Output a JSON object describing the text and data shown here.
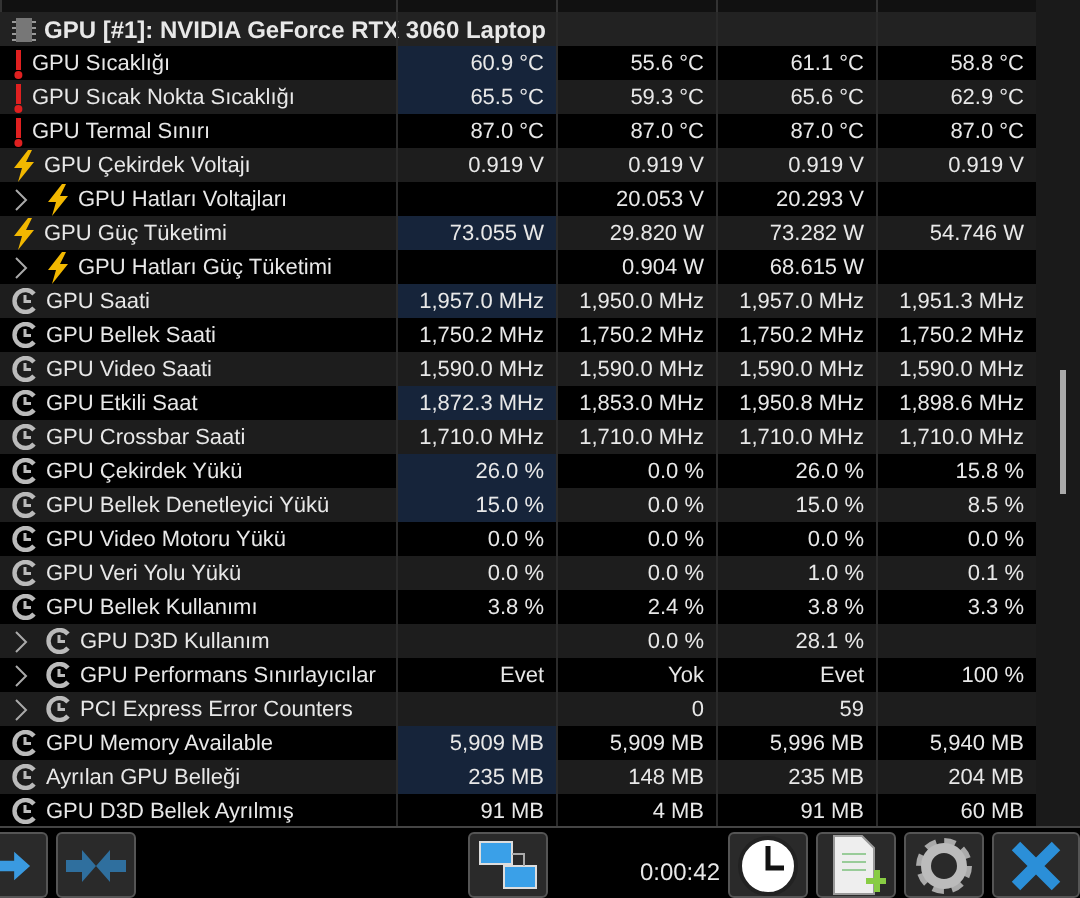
{
  "device": {
    "title": "GPU [#1]: NVIDIA GeForce RTX 3060 Laptop"
  },
  "sensors": [
    {
      "name": "GPU Sıcaklığı",
      "kind": "temperature",
      "highlighted": true,
      "values": {
        "value_1": "60.9 °C",
        "value_2": "55.6 °C",
        "value_3": "61.1 °C",
        "value_4": "58.8 °C"
      }
    },
    {
      "name": "GPU Sıcak Nokta Sıcaklığı",
      "kind": "temperature",
      "highlighted": true,
      "values": {
        "value_1": "65.5 °C",
        "value_2": "59.3 °C",
        "value_3": "65.6 °C",
        "value_4": "62.9 °C"
      }
    },
    {
      "name": "GPU Termal Sınırı",
      "kind": "temperature",
      "highlighted": false,
      "values": {
        "value_1": "87.0 °C",
        "value_2": "87.0 °C",
        "value_3": "87.0 °C",
        "value_4": "87.0 °C"
      }
    },
    {
      "name": "GPU Çekirdek Voltajı",
      "kind": "power",
      "highlighted": false,
      "values": {
        "value_1": "0.919 V",
        "value_2": "0.919 V",
        "value_3": "0.919 V",
        "value_4": "0.919 V"
      }
    },
    {
      "name": "GPU Hatları Voltajları",
      "kind": "power",
      "expanded": false,
      "highlighted": false,
      "values": {
        "value_2": "20.053 V",
        "value_3": "20.293 V"
      }
    },
    {
      "name": "GPU Güç Tüketimi",
      "kind": "power",
      "highlighted": true,
      "values": {
        "value_1": "73.055 W",
        "value_2": "29.820 W",
        "value_3": "73.282 W",
        "value_4": "54.746 W"
      }
    },
    {
      "name": "GPU Hatları Güç Tüketimi",
      "kind": "power",
      "expanded": false,
      "highlighted": false,
      "values": {
        "value_2": "0.904 W",
        "value_3": "68.615 W"
      }
    },
    {
      "name": "GPU Saati",
      "kind": "clock",
      "highlighted": true,
      "values": {
        "value_1": "1,957.0 MHz",
        "value_2": "1,950.0 MHz",
        "value_3": "1,957.0 MHz",
        "value_4": "1,951.3 MHz"
      }
    },
    {
      "name": "GPU Bellek Saati",
      "kind": "clock",
      "highlighted": false,
      "values": {
        "value_1": "1,750.2 MHz",
        "value_2": "1,750.2 MHz",
        "value_3": "1,750.2 MHz",
        "value_4": "1,750.2 MHz"
      }
    },
    {
      "name": "GPU Video Saati",
      "kind": "clock",
      "highlighted": false,
      "values": {
        "value_1": "1,590.0 MHz",
        "value_2": "1,590.0 MHz",
        "value_3": "1,590.0 MHz",
        "value_4": "1,590.0 MHz"
      }
    },
    {
      "name": "GPU Etkili Saat",
      "kind": "clock",
      "highlighted": true,
      "values": {
        "value_1": "1,872.3 MHz",
        "value_2": "1,853.0 MHz",
        "value_3": "1,950.8 MHz",
        "value_4": "1,898.6 MHz"
      }
    },
    {
      "name": "GPU Crossbar Saati",
      "kind": "clock",
      "highlighted": false,
      "values": {
        "value_1": "1,710.0 MHz",
        "value_2": "1,710.0 MHz",
        "value_3": "1,710.0 MHz",
        "value_4": "1,710.0 MHz"
      }
    },
    {
      "name": "GPU Çekirdek Yükü",
      "kind": "clock",
      "highlighted": true,
      "values": {
        "value_1": "26.0 %",
        "value_2": "0.0 %",
        "value_3": "26.0 %",
        "value_4": "15.8 %"
      }
    },
    {
      "name": "GPU Bellek Denetleyici Yükü",
      "kind": "clock",
      "highlighted": true,
      "values": {
        "value_1": "15.0 %",
        "value_2": "0.0 %",
        "value_3": "15.0 %",
        "value_4": "8.5 %"
      }
    },
    {
      "name": "GPU Video Motoru Yükü",
      "kind": "clock",
      "highlighted": false,
      "values": {
        "value_1": "0.0 %",
        "value_2": "0.0 %",
        "value_3": "0.0 %",
        "value_4": "0.0 %"
      }
    },
    {
      "name": "GPU Veri Yolu Yükü",
      "kind": "clock",
      "highlighted": false,
      "values": {
        "value_1": "0.0 %",
        "value_2": "0.0 %",
        "value_3": "1.0 %",
        "value_4": "0.1 %"
      }
    },
    {
      "name": "GPU Bellek Kullanımı",
      "kind": "clock",
      "highlighted": false,
      "values": {
        "value_1": "3.8 %",
        "value_2": "2.4 %",
        "value_3": "3.8 %",
        "value_4": "3.3 %"
      }
    },
    {
      "name": "GPU D3D Kullanım",
      "kind": "clock",
      "expanded": false,
      "highlighted": false,
      "values": {
        "value_2": "0.0 %",
        "value_3": "28.1 %"
      }
    },
    {
      "name": "GPU Performans Sınırlayıcılar",
      "kind": "clock",
      "expanded": false,
      "highlighted": false,
      "values": {
        "value_1": "Evet",
        "value_2": "Yok",
        "value_3": "Evet",
        "value_4": "100 %"
      }
    },
    {
      "name": "PCI Express Error Counters",
      "kind": "clock",
      "expanded": false,
      "highlighted": false,
      "values": {
        "value_2": "0",
        "value_3": "59"
      }
    },
    {
      "name": "GPU Memory Available",
      "kind": "clock",
      "highlighted": true,
      "values": {
        "value_1": "5,909 MB",
        "value_2": "5,909 MB",
        "value_3": "5,996 MB",
        "value_4": "5,940 MB"
      }
    },
    {
      "name": "Ayrılan GPU Belleği",
      "kind": "clock",
      "highlighted": true,
      "values": {
        "value_1": "235 MB",
        "value_2": "148 MB",
        "value_3": "235 MB",
        "value_4": "204 MB"
      }
    },
    {
      "name": "GPU D3D Bellek Ayrılmış",
      "kind": "clock",
      "highlighted": false,
      "values": {
        "value_1": "91 MB",
        "value_2": "4 MB",
        "value_3": "91 MB",
        "value_4": "60 MB"
      }
    }
  ],
  "toolbar": {
    "timer": "0:00:42"
  }
}
